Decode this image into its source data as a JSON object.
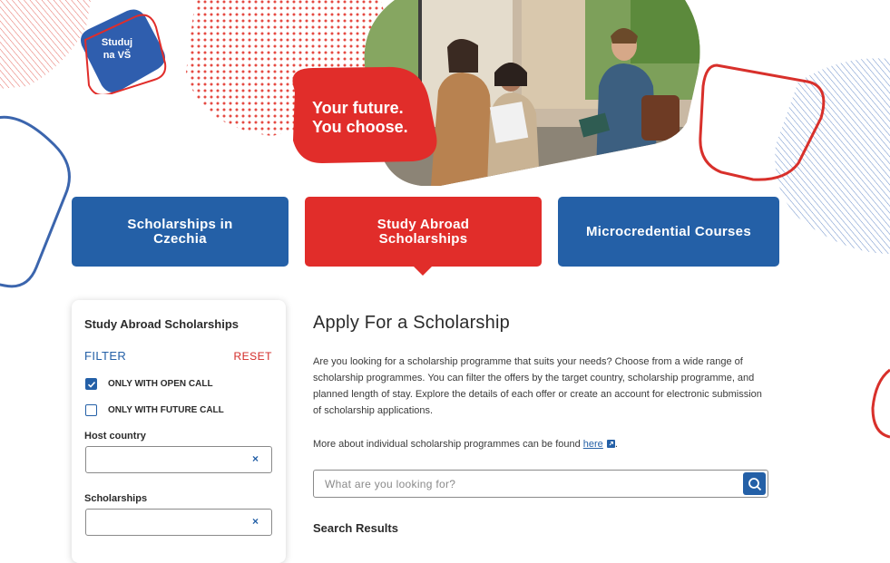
{
  "brand": {
    "logo_line1": "Studuj",
    "logo_line2": "na VŠ"
  },
  "hero": {
    "slogan": "Your future.\nYou choose."
  },
  "categories": [
    {
      "label": "Scholarships in Czechia",
      "active": false
    },
    {
      "label": "Study Abroad Scholarships",
      "active": true
    },
    {
      "label": "Microcredential Courses",
      "active": false
    }
  ],
  "sidebar": {
    "title": "Study Abroad Scholarships",
    "filter_label": "FILTER",
    "reset_label": "RESET",
    "checkboxes": [
      {
        "label": "ONLY WITH OPEN CALL",
        "checked": true
      },
      {
        "label": "ONLY WITH FUTURE CALL",
        "checked": false
      }
    ],
    "fields": [
      {
        "label": "Host country",
        "value": "",
        "clear": "×"
      },
      {
        "label": "Scholarships",
        "value": "",
        "clear": "×"
      }
    ]
  },
  "main": {
    "title": "Apply For a Scholarship",
    "intro": "Are you looking for a scholarship programme that suits your needs? Choose from a wide range of scholarship programmes. You can filter the offers by the target country, scholarship programme, and planned length of stay. Explore the details of each offer or create an account for electronic submission of scholarship applications.",
    "more_prefix": "More about individual scholarship programmes can be found ",
    "more_link": "here",
    "more_suffix": ".",
    "search_placeholder": "What are you looking for?",
    "results_title": "Search Results"
  },
  "colors": {
    "brand_blue": "#2460a7",
    "brand_red": "#e12d2a"
  },
  "icons": [
    "logo-badge",
    "external-link-icon",
    "search-icon",
    "checkmark-icon",
    "close-icon"
  ]
}
